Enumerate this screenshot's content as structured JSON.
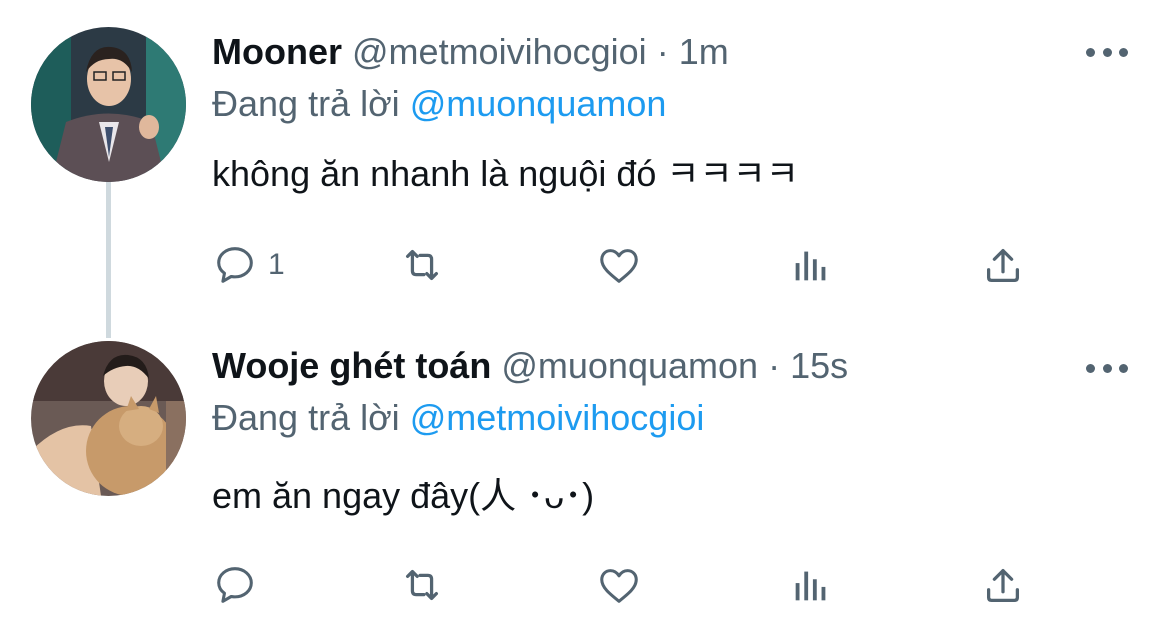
{
  "tweets": [
    {
      "name": "Mooner",
      "handle": "@metmoivihocgioi",
      "separator": "·",
      "time": "1m",
      "reply_prefix": "Đang trả lời",
      "reply_to": "@muonquamon",
      "text": "không ăn nhanh là nguội đó ㅋㅋㅋㅋ",
      "reply_count": "1",
      "avatar_icon": "avatar-photo"
    },
    {
      "name": "Wooje ghét toán",
      "handle": "@muonquamon",
      "separator": "·",
      "time": "15s",
      "reply_prefix": "Đang trả lời",
      "reply_to": "@metmoivihocgioi",
      "text": "em ăn ngay đây(人 ･ᴗ･)",
      "reply_count": "",
      "avatar_icon": "avatar-photo"
    }
  ],
  "icons": [
    "reply-icon",
    "retweet-icon",
    "like-icon",
    "analytics-icon",
    "share-icon",
    "more-icon"
  ],
  "colors": {
    "text": "#0f1419",
    "secondary": "#536471",
    "link": "#1d9bf0",
    "thread_line": "#cfd9de"
  }
}
